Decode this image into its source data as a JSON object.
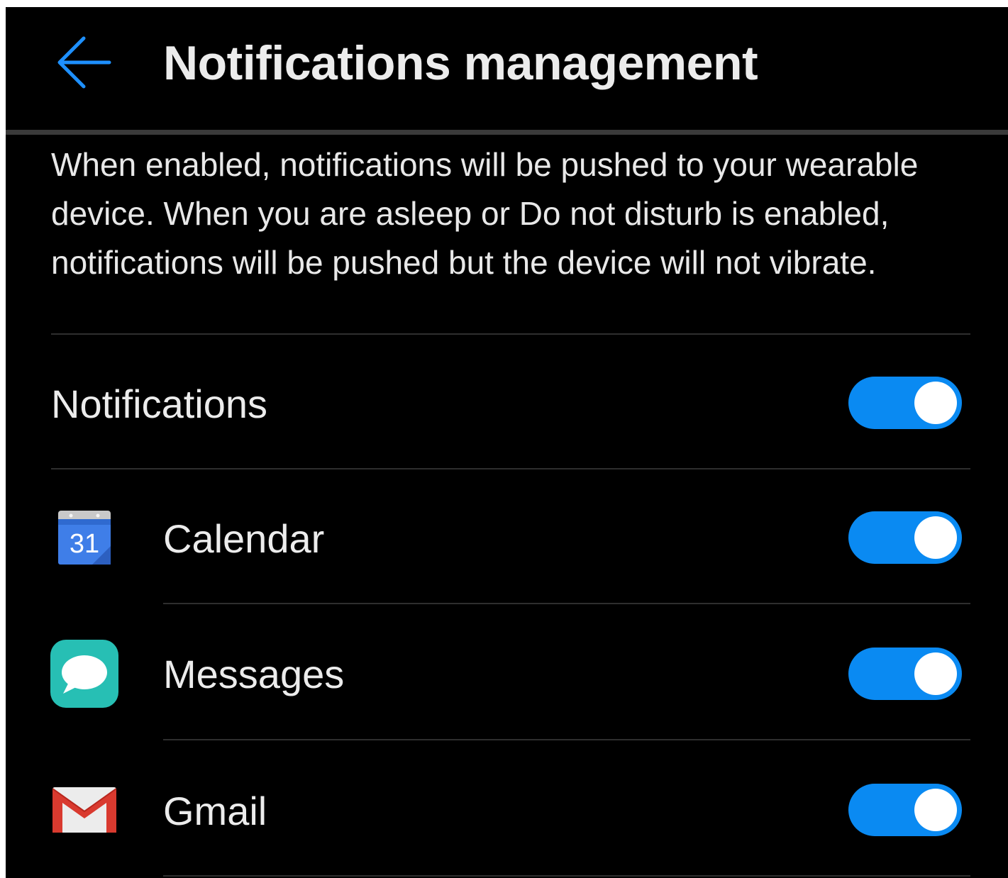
{
  "header": {
    "title": "Notifications management",
    "back_icon": "back-arrow-icon",
    "accent_color": "#1e90ff"
  },
  "description": "When enabled, notifications will be pushed to your wearable device. When you are asleep or Do not disturb is enabled, notifications will be pushed but the device will not vibrate.",
  "master_toggle": {
    "label": "Notifications",
    "enabled": true
  },
  "apps": [
    {
      "name": "Calendar",
      "icon": "calendar-icon",
      "icon_text": "31",
      "enabled": true
    },
    {
      "name": "Messages",
      "icon": "messages-icon",
      "enabled": true
    },
    {
      "name": "Gmail",
      "icon": "gmail-icon",
      "enabled": true
    }
  ],
  "colors": {
    "background": "#000000",
    "toggle_on": "#0a8af2",
    "text": "#ececec"
  }
}
